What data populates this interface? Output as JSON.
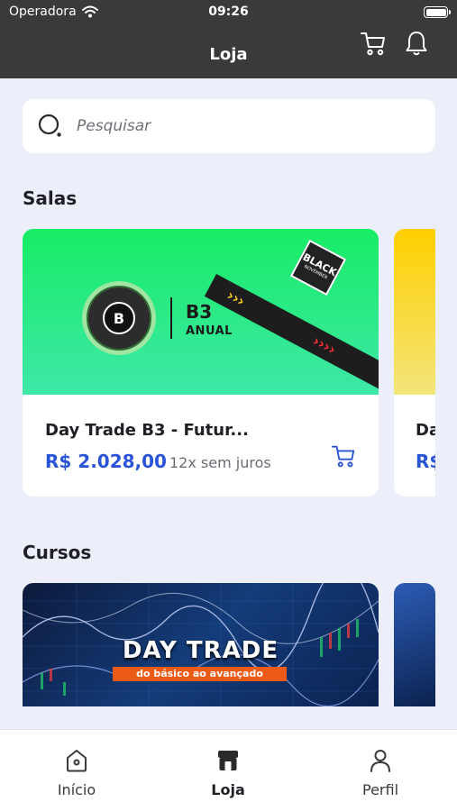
{
  "status_bar": {
    "carrier": "Operadora",
    "time": "09:26"
  },
  "header": {
    "title": "Loja"
  },
  "search": {
    "placeholder": "Pesquisar"
  },
  "sections": {
    "salas": "Salas",
    "cursos": "Cursos"
  },
  "salas": [
    {
      "banner_title": "B3",
      "banner_subtitle": "ANUAL",
      "logo_letter": "B",
      "badge_main": "BLACK",
      "badge_sub": "NOVEMBER",
      "name": "Day Trade B3 - Futur...",
      "price": "R$ 2.028,00",
      "installments": "12x sem juros"
    },
    {
      "name": "Da",
      "price": "R$"
    }
  ],
  "cursos": [
    {
      "title": "DAY TRADE",
      "subtitle": "do básico ao avançado"
    }
  ],
  "tabbar": [
    {
      "label": "Início",
      "icon": "home-icon",
      "active": false
    },
    {
      "label": "Loja",
      "icon": "store-icon",
      "active": true
    },
    {
      "label": "Perfil",
      "icon": "person-icon",
      "active": false
    }
  ],
  "colors": {
    "header_bg": "#3a3a3a",
    "price": "#2a54d8",
    "background": "#eceef9"
  }
}
